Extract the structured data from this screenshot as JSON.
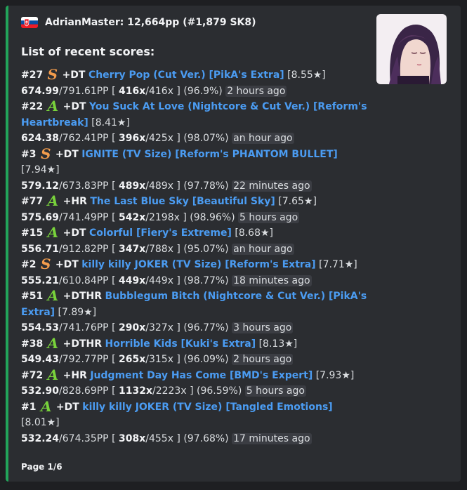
{
  "author": {
    "name": "AdrianMaster: 12,664pp (#1,879 SK8)",
    "flag_icon": "slovakia-flag-icon"
  },
  "title": "List of recent scores:",
  "scores": [
    {
      "rank": "#27",
      "grade": "S",
      "mods": "+DT",
      "map": "Cherry Pop (Cut Ver.) [PikA's Extra]",
      "stars": "[8.55★]",
      "pp": "674.99",
      "max_pp": "/791.61PP [ ",
      "combo": "416x",
      "max_combo": "/416x ] (96.9%)",
      "time": "2 hours ago"
    },
    {
      "rank": "#22",
      "grade": "A",
      "mods": "+DT",
      "map": "You Suck At Love (Nightcore & Cut Ver.) [Reform's Heartbreak]",
      "stars": "[8.41★]",
      "pp": "624.38",
      "max_pp": "/762.41PP [ ",
      "combo": "396x",
      "max_combo": "/425x ] (98.07%)",
      "time": "an hour ago"
    },
    {
      "rank": "#3",
      "grade": "S",
      "mods": "+DT",
      "map": "IGNITE (TV Size) [Reform's PHANTOM BULLET]",
      "stars": "[7.94★]",
      "pp": "579.12",
      "max_pp": "/673.83PP [ ",
      "combo": "489x",
      "max_combo": "/489x ] (97.78%)",
      "time": "22 minutes ago"
    },
    {
      "rank": "#77",
      "grade": "A",
      "mods": "+HR",
      "map": "The Last Blue Sky [Beautiful Sky]",
      "stars": "[7.65★]",
      "pp": "575.69",
      "max_pp": "/741.49PP [ ",
      "combo": "542x",
      "max_combo": "/2198x ] (98.96%)",
      "time": "5 hours ago"
    },
    {
      "rank": "#15",
      "grade": "A",
      "mods": "+DT",
      "map": "Colorful [Fiery's Extreme]",
      "stars": "[8.68★]",
      "pp": "556.71",
      "max_pp": "/912.82PP [ ",
      "combo": "347x",
      "max_combo": "/788x ] (95.07%)",
      "time": "an hour ago"
    },
    {
      "rank": "#2",
      "grade": "S",
      "mods": "+DT",
      "map": "killy killy JOKER (TV Size) [Reform's Extra]",
      "stars": "[7.71★]",
      "pp": "555.21",
      "max_pp": "/610.84PP [ ",
      "combo": "449x",
      "max_combo": "/449x ] (98.77%)",
      "time": "18 minutes ago"
    },
    {
      "rank": "#51",
      "grade": "A",
      "mods": "+DTHR",
      "map": "Bubblegum Bitch (Nightcore & Cut Ver.) [PikA's Extra]",
      "stars": "[7.89★]",
      "pp": "554.53",
      "max_pp": "/741.76PP [ ",
      "combo": "290x",
      "max_combo": "/327x ] (96.77%)",
      "time": "3 hours ago"
    },
    {
      "rank": "#38",
      "grade": "A",
      "mods": "+DTHR",
      "map": "Horrible Kids [Kuki's Extra]",
      "stars": "[8.13★]",
      "pp": "549.43",
      "max_pp": "/792.77PP [ ",
      "combo": "265x",
      "max_combo": "/315x ] (96.09%)",
      "time": "2 hours ago"
    },
    {
      "rank": "#72",
      "grade": "A",
      "mods": "+HR",
      "map": "Judgment Day Has Come [BMD's Expert]",
      "stars": "[7.93★]",
      "pp": "532.90",
      "max_pp": "/828.69PP [ ",
      "combo": "1132x",
      "max_combo": "/2223x ] (96.59%)",
      "time": "5 hours ago"
    },
    {
      "rank": "#1",
      "grade": "A",
      "mods": "+DT",
      "map": "killy killy JOKER (TV Size) [Tangled Emotions]",
      "stars": "[8.01★]",
      "pp": "532.24",
      "max_pp": "/674.35PP [ ",
      "combo": "308x",
      "max_combo": "/455x ] (97.68%)",
      "time": "17 minutes ago"
    }
  ],
  "footer": "Page 1/6",
  "thumbnail_icon": "anime-avatar-icon",
  "colors": {
    "accent_border": "#22a45a",
    "link": "#4b9cf2",
    "grade_s": "#f39c4c",
    "grade_a": "#78d23b"
  }
}
